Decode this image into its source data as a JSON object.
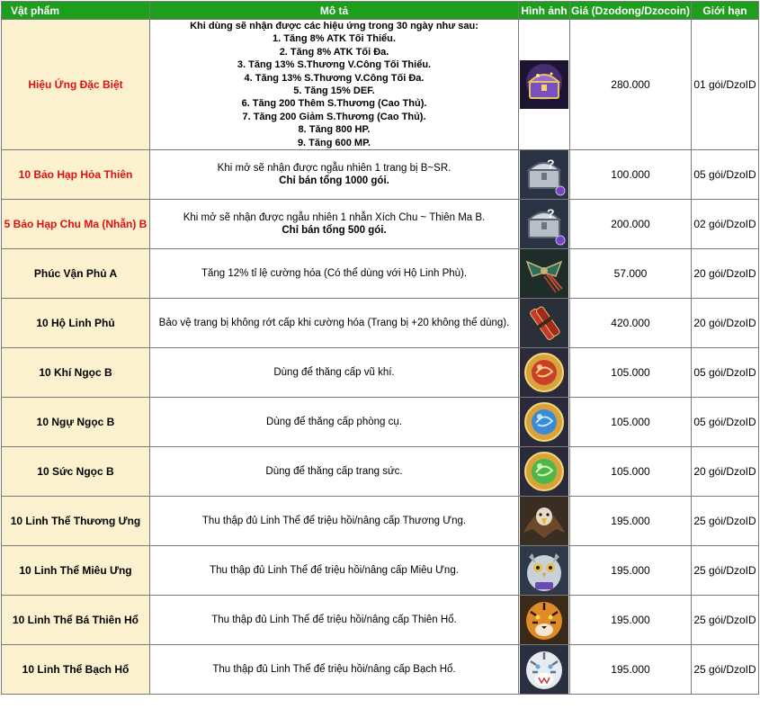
{
  "headers": {
    "item": "Vật phẩm",
    "description": "Mô tả",
    "image": "Hình ảnh",
    "price": "Giá (Dzodong/Dzocoin)",
    "limit": "Giới hạn"
  },
  "rows": [
    {
      "name": "Hiệu Ứng Đặc Biệt",
      "name_color": "#e01010",
      "description_intro": "Khi dùng sẽ nhận được các hiệu ứng trong 30 ngày như sau:",
      "description_lines": [
        "1. Tăng 8% ATK Tối Thiểu.",
        "2. Tăng 8% ATK Tối Đa.",
        "3. Tăng 13% S.Thương V.Công Tối Thiểu.",
        "4. Tăng 13% S.Thương V.Công Tối Đa.",
        "5. Tăng 15% DEF.",
        "6. Tăng 200 Thêm S.Thương (Cao Thủ).",
        "7. Tăng 200 Giảm S.Thương (Cao Thủ).",
        "8. Tăng 800 HP.",
        "9. Tăng 600 MP."
      ],
      "icon": "purple-treasure-chest-icon",
      "price": "280.000",
      "limit": "01 gói/DzoID"
    },
    {
      "name": "10 Bảo Hạp Hỏa Thiên",
      "name_color": "#e01010",
      "description": "Khi mở sẽ nhận được ngẫu nhiên 1 trang bị B~SR.",
      "note": "Chỉ bán tổng 1000 gói.",
      "icon": "silver-chest-icon",
      "price": "100.000",
      "limit": "05 gói/DzoID"
    },
    {
      "name": "5 Bảo Hạp Chu Ma (Nhẫn) B",
      "name_color": "#e01010",
      "description": "Khi mở sẽ nhận được ngẫu nhiên 1 nhẫn Xích Chu ~ Thiên Ma B.",
      "note": "Chỉ bán tổng 500 gói.",
      "icon": "silver-chest-icon",
      "price": "200.000",
      "limit": "02 gói/DzoID"
    },
    {
      "name": "Phúc Vận Phủ A",
      "description": "Tăng 12% tỉ lệ cường hóa (Có thể dùng với Hộ Linh Phù).",
      "icon": "talisman-charm-icon",
      "price": "57.000",
      "limit": "20 gói/DzoID"
    },
    {
      "name": "10 Hộ Linh Phủ",
      "description": "Bảo vệ trang bị không rớt cấp khi cường hóa (Trang bị +20 không thể dùng).",
      "icon": "scroll-bundle-icon",
      "price": "420.000",
      "limit": "20 gói/DzoID"
    },
    {
      "name": "10 Khí Ngọc B",
      "description": "Dùng để thăng cấp vũ khí.",
      "icon": "red-orb-icon",
      "price": "105.000",
      "limit": "05 gói/DzoID"
    },
    {
      "name": "10 Ngự Ngọc B",
      "description": "Dùng để thăng cấp phòng cụ.",
      "icon": "blue-orb-icon",
      "price": "105.000",
      "limit": "05 gói/DzoID"
    },
    {
      "name": "10 Sức Ngọc B",
      "description": "Dùng để thăng cấp trang sức.",
      "icon": "green-orb-icon",
      "price": "105.000",
      "limit": "20 gói/DzoID"
    },
    {
      "name": "10 Linh Thể Thương Ưng",
      "description": "Thu thập đủ Linh Thể để triệu hồi/nâng cấp Thương Ưng.",
      "icon": "eagle-spirit-icon",
      "price": "195.000",
      "limit": "25 gói/DzoID"
    },
    {
      "name": "10 Linh Thể Miêu Ưng",
      "description": "Thu thập đủ Linh Thể để triệu hồi/nâng cấp Miêu Ưng.",
      "icon": "owl-spirit-icon",
      "price": "195.000",
      "limit": "25 gói/DzoID"
    },
    {
      "name": "10 Linh Thể Bá Thiên Hổ",
      "description": "Thu thập đủ Linh Thể để triệu hồi/nâng cấp Thiên Hổ.",
      "icon": "tiger-spirit-icon",
      "price": "195.000",
      "limit": "25 gói/DzoID"
    },
    {
      "name": "10 Linh Thể Bạch Hổ",
      "description": "Thu thập đủ Linh Thể để triệu hồi/nâng cấp Bạch Hổ.",
      "icon": "white-tiger-spirit-icon",
      "price": "195.000",
      "limit": "25 gói/DzoID"
    }
  ]
}
